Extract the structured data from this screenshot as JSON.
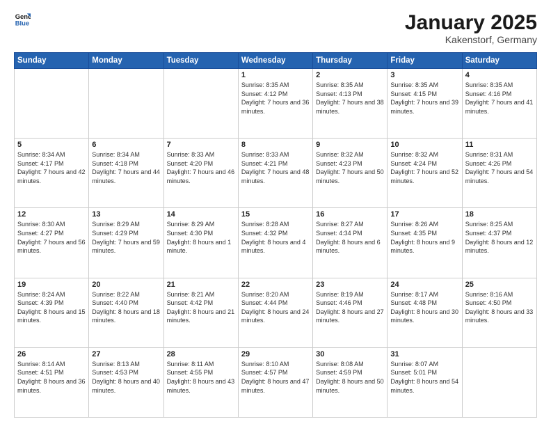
{
  "header": {
    "logo_general": "General",
    "logo_blue": "Blue",
    "month_title": "January 2025",
    "location": "Kakenstorf, Germany"
  },
  "weekdays": [
    "Sunday",
    "Monday",
    "Tuesday",
    "Wednesday",
    "Thursday",
    "Friday",
    "Saturday"
  ],
  "weeks": [
    [
      {
        "day": "",
        "info": ""
      },
      {
        "day": "",
        "info": ""
      },
      {
        "day": "",
        "info": ""
      },
      {
        "day": "1",
        "info": "Sunrise: 8:35 AM\nSunset: 4:12 PM\nDaylight: 7 hours and 36 minutes."
      },
      {
        "day": "2",
        "info": "Sunrise: 8:35 AM\nSunset: 4:13 PM\nDaylight: 7 hours and 38 minutes."
      },
      {
        "day": "3",
        "info": "Sunrise: 8:35 AM\nSunset: 4:15 PM\nDaylight: 7 hours and 39 minutes."
      },
      {
        "day": "4",
        "info": "Sunrise: 8:35 AM\nSunset: 4:16 PM\nDaylight: 7 hours and 41 minutes."
      }
    ],
    [
      {
        "day": "5",
        "info": "Sunrise: 8:34 AM\nSunset: 4:17 PM\nDaylight: 7 hours and 42 minutes."
      },
      {
        "day": "6",
        "info": "Sunrise: 8:34 AM\nSunset: 4:18 PM\nDaylight: 7 hours and 44 minutes."
      },
      {
        "day": "7",
        "info": "Sunrise: 8:33 AM\nSunset: 4:20 PM\nDaylight: 7 hours and 46 minutes."
      },
      {
        "day": "8",
        "info": "Sunrise: 8:33 AM\nSunset: 4:21 PM\nDaylight: 7 hours and 48 minutes."
      },
      {
        "day": "9",
        "info": "Sunrise: 8:32 AM\nSunset: 4:23 PM\nDaylight: 7 hours and 50 minutes."
      },
      {
        "day": "10",
        "info": "Sunrise: 8:32 AM\nSunset: 4:24 PM\nDaylight: 7 hours and 52 minutes."
      },
      {
        "day": "11",
        "info": "Sunrise: 8:31 AM\nSunset: 4:26 PM\nDaylight: 7 hours and 54 minutes."
      }
    ],
    [
      {
        "day": "12",
        "info": "Sunrise: 8:30 AM\nSunset: 4:27 PM\nDaylight: 7 hours and 56 minutes."
      },
      {
        "day": "13",
        "info": "Sunrise: 8:29 AM\nSunset: 4:29 PM\nDaylight: 7 hours and 59 minutes."
      },
      {
        "day": "14",
        "info": "Sunrise: 8:29 AM\nSunset: 4:30 PM\nDaylight: 8 hours and 1 minute."
      },
      {
        "day": "15",
        "info": "Sunrise: 8:28 AM\nSunset: 4:32 PM\nDaylight: 8 hours and 4 minutes."
      },
      {
        "day": "16",
        "info": "Sunrise: 8:27 AM\nSunset: 4:34 PM\nDaylight: 8 hours and 6 minutes."
      },
      {
        "day": "17",
        "info": "Sunrise: 8:26 AM\nSunset: 4:35 PM\nDaylight: 8 hours and 9 minutes."
      },
      {
        "day": "18",
        "info": "Sunrise: 8:25 AM\nSunset: 4:37 PM\nDaylight: 8 hours and 12 minutes."
      }
    ],
    [
      {
        "day": "19",
        "info": "Sunrise: 8:24 AM\nSunset: 4:39 PM\nDaylight: 8 hours and 15 minutes."
      },
      {
        "day": "20",
        "info": "Sunrise: 8:22 AM\nSunset: 4:40 PM\nDaylight: 8 hours and 18 minutes."
      },
      {
        "day": "21",
        "info": "Sunrise: 8:21 AM\nSunset: 4:42 PM\nDaylight: 8 hours and 21 minutes."
      },
      {
        "day": "22",
        "info": "Sunrise: 8:20 AM\nSunset: 4:44 PM\nDaylight: 8 hours and 24 minutes."
      },
      {
        "day": "23",
        "info": "Sunrise: 8:19 AM\nSunset: 4:46 PM\nDaylight: 8 hours and 27 minutes."
      },
      {
        "day": "24",
        "info": "Sunrise: 8:17 AM\nSunset: 4:48 PM\nDaylight: 8 hours and 30 minutes."
      },
      {
        "day": "25",
        "info": "Sunrise: 8:16 AM\nSunset: 4:50 PM\nDaylight: 8 hours and 33 minutes."
      }
    ],
    [
      {
        "day": "26",
        "info": "Sunrise: 8:14 AM\nSunset: 4:51 PM\nDaylight: 8 hours and 36 minutes."
      },
      {
        "day": "27",
        "info": "Sunrise: 8:13 AM\nSunset: 4:53 PM\nDaylight: 8 hours and 40 minutes."
      },
      {
        "day": "28",
        "info": "Sunrise: 8:11 AM\nSunset: 4:55 PM\nDaylight: 8 hours and 43 minutes."
      },
      {
        "day": "29",
        "info": "Sunrise: 8:10 AM\nSunset: 4:57 PM\nDaylight: 8 hours and 47 minutes."
      },
      {
        "day": "30",
        "info": "Sunrise: 8:08 AM\nSunset: 4:59 PM\nDaylight: 8 hours and 50 minutes."
      },
      {
        "day": "31",
        "info": "Sunrise: 8:07 AM\nSunset: 5:01 PM\nDaylight: 8 hours and 54 minutes."
      },
      {
        "day": "",
        "info": ""
      }
    ]
  ]
}
